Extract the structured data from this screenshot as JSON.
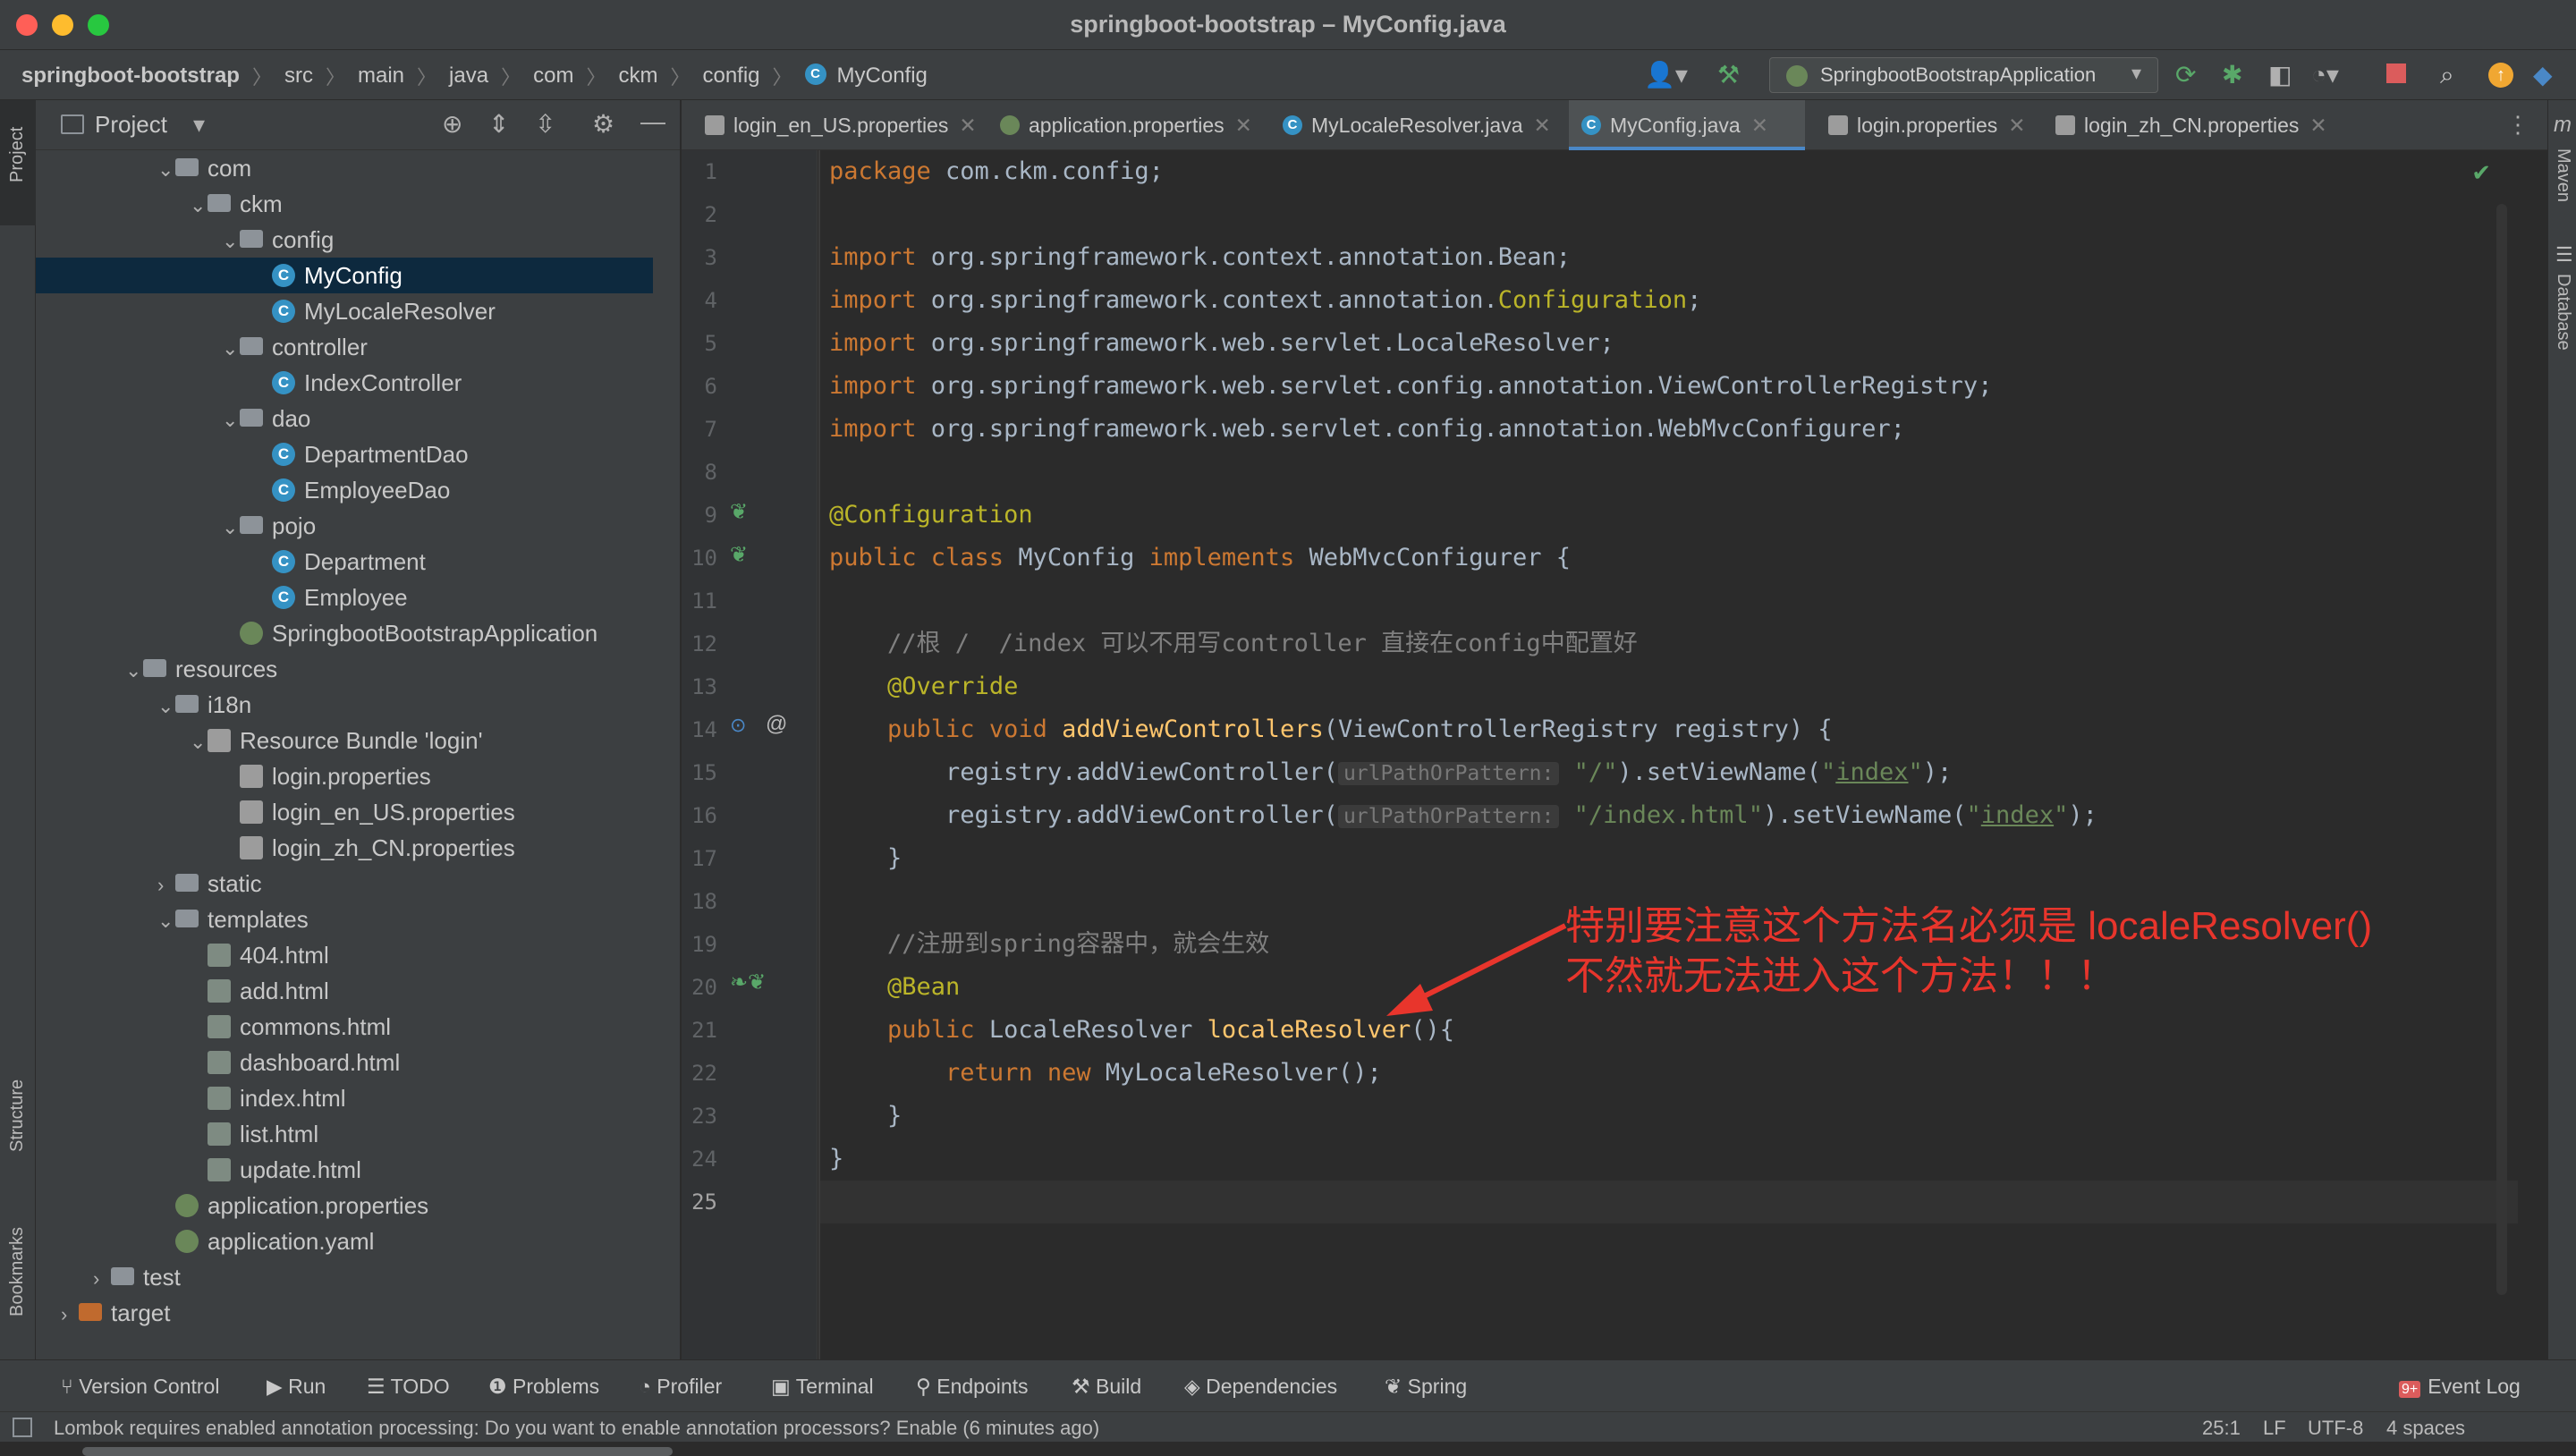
{
  "window": {
    "title": "springboot-bootstrap – MyConfig.java"
  },
  "breadcrumb": [
    "springboot-bootstrap",
    "src",
    "main",
    "java",
    "com",
    "ckm",
    "config",
    "MyConfig"
  ],
  "run_config": "SpringbootBootstrapApplication",
  "project_panel": {
    "title": "Project"
  },
  "tree": [
    {
      "label": "com",
      "type": "folder",
      "open": true,
      "depth": 4
    },
    {
      "label": "ckm",
      "type": "folder",
      "open": true,
      "depth": 5
    },
    {
      "label": "config",
      "type": "folder",
      "open": true,
      "depth": 6
    },
    {
      "label": "MyConfig",
      "type": "class",
      "depth": 7,
      "selected": true
    },
    {
      "label": "MyLocaleResolver",
      "type": "class",
      "depth": 7
    },
    {
      "label": "controller",
      "type": "folder",
      "open": true,
      "depth": 6
    },
    {
      "label": "IndexController",
      "type": "class",
      "depth": 7
    },
    {
      "label": "dao",
      "type": "folder",
      "open": true,
      "depth": 6
    },
    {
      "label": "DepartmentDao",
      "type": "class",
      "depth": 7
    },
    {
      "label": "EmployeeDao",
      "type": "class",
      "depth": 7
    },
    {
      "label": "pojo",
      "type": "folder",
      "open": true,
      "depth": 6
    },
    {
      "label": "Department",
      "type": "class",
      "depth": 7
    },
    {
      "label": "Employee",
      "type": "class",
      "depth": 7
    },
    {
      "label": "SpringbootBootstrapApplication",
      "type": "spring",
      "depth": 6
    },
    {
      "label": "resources",
      "type": "folder",
      "open": true,
      "depth": 3
    },
    {
      "label": "i18n",
      "type": "folder",
      "open": true,
      "depth": 4
    },
    {
      "label": "Resource Bundle 'login'",
      "type": "props",
      "open": true,
      "depth": 5
    },
    {
      "label": "login.properties",
      "type": "props",
      "depth": 6
    },
    {
      "label": "login_en_US.properties",
      "type": "props",
      "depth": 6
    },
    {
      "label": "login_zh_CN.properties",
      "type": "props",
      "depth": 6
    },
    {
      "label": "static",
      "type": "folder",
      "open": false,
      "depth": 4
    },
    {
      "label": "templates",
      "type": "folder",
      "open": true,
      "depth": 4
    },
    {
      "label": "404.html",
      "type": "html",
      "depth": 5
    },
    {
      "label": "add.html",
      "type": "html",
      "depth": 5
    },
    {
      "label": "commons.html",
      "type": "html",
      "depth": 5
    },
    {
      "label": "dashboard.html",
      "type": "html",
      "depth": 5
    },
    {
      "label": "index.html",
      "type": "html",
      "depth": 5
    },
    {
      "label": "list.html",
      "type": "html",
      "depth": 5
    },
    {
      "label": "update.html",
      "type": "html",
      "depth": 5
    },
    {
      "label": "application.properties",
      "type": "spring",
      "depth": 4
    },
    {
      "label": "application.yaml",
      "type": "spring",
      "depth": 4
    },
    {
      "label": "test",
      "type": "folder",
      "open": false,
      "depth": 2
    },
    {
      "label": "target",
      "type": "target",
      "open": false,
      "depth": 1
    }
  ],
  "tabs": [
    {
      "label": "login_en_US.properties"
    },
    {
      "label": "application.properties"
    },
    {
      "label": "MyLocaleResolver.java"
    },
    {
      "label": "MyConfig.java",
      "active": true
    },
    {
      "label": "login.properties"
    },
    {
      "label": "login_zh_CN.properties"
    }
  ],
  "code": {
    "line_count": 25,
    "current_line": 25,
    "pkg": "com.ckm.config",
    "imports": [
      "org.springframework.context.annotation.",
      "org.springframework.context.annotation.",
      "org.springframework.web.servlet.LocaleResolver",
      "org.springframework.web.servlet.config.annotation.ViewControllerRegistry",
      "org.springframework.web.servlet.config.annotation.WebMvcConfigurer"
    ],
    "import_tail_1": "Bean",
    "import_tail_2": "Configuration",
    "comment1": "//根 /  /index 可以不用写controller 直接在config中配置好",
    "comment2": "//注册到spring容器中，就会生效",
    "hint": "urlPathOrPattern:",
    "path1": "\"/\"",
    "path2": "\"/index.html\"",
    "view": "index"
  },
  "annotation_note": {
    "line1": "特别要注意这个方法名必须是 localeResolver()",
    "line2": "不然就无法进入这个方法！！！"
  },
  "left_strip": [
    "Project",
    "Structure",
    "Bookmarks"
  ],
  "right_strip": [
    "Maven",
    "Database"
  ],
  "bottom_tools": [
    "Version Control",
    "Run",
    "TODO",
    "Problems",
    "Profiler",
    "Terminal",
    "Endpoints",
    "Build",
    "Dependencies",
    "Spring"
  ],
  "event_log": "Event Log",
  "event_badge": "9+",
  "status": {
    "message": "Lombok requires enabled annotation processing: Do you want to enable annotation processors? Enable (6 minutes ago)",
    "position": "25:1",
    "line_sep": "LF",
    "encoding": "UTF-8",
    "indent": "4 spaces"
  },
  "colors": {
    "accent": "#4a88c7",
    "keyword": "#cc7832",
    "annotation": "#bbb529",
    "string": "#6a8759",
    "note": "#e8352c"
  }
}
